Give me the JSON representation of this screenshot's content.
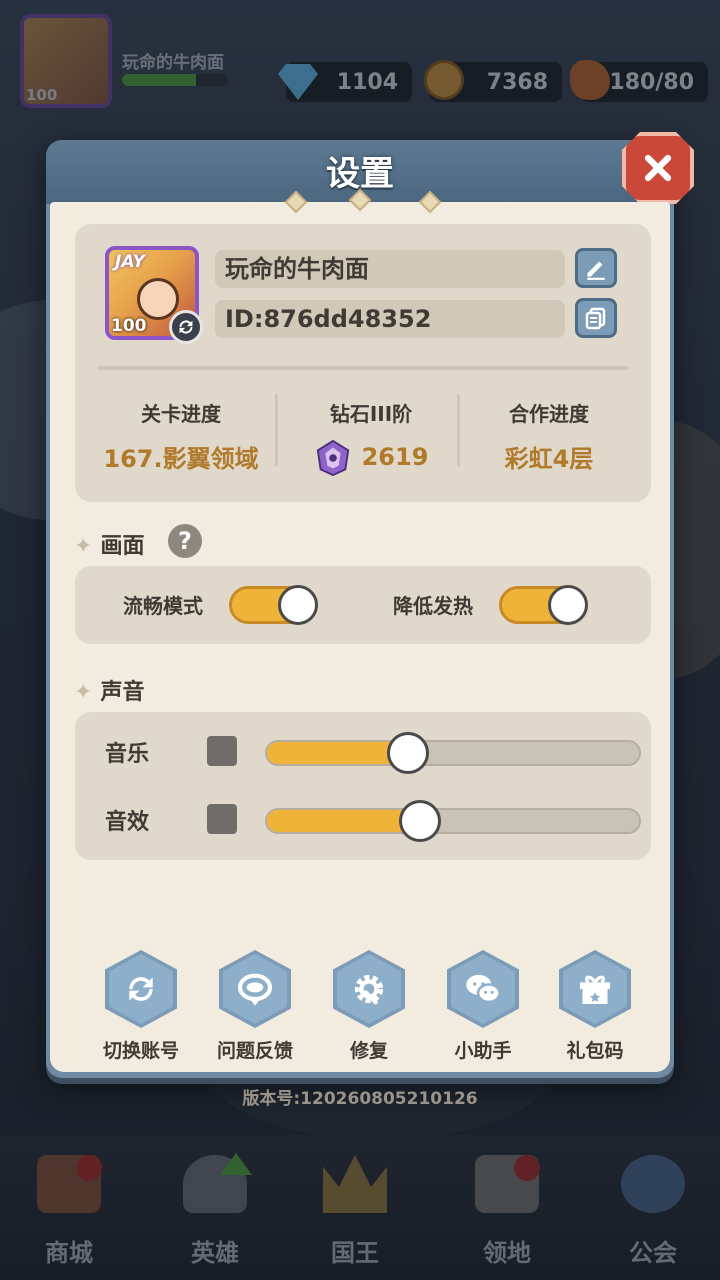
{
  "hud": {
    "player_name": "玩命的牛肉面",
    "player_level": "100",
    "xp_progress_pct": 70,
    "diamonds": "1104",
    "coins": "7368",
    "stamina": "180/80"
  },
  "dialog": {
    "title": "设置",
    "profile": {
      "brand": "JAY",
      "level": "100",
      "name": "玩命的牛肉面",
      "id": "ID:876dd48352",
      "stats": [
        {
          "label": "关卡进度",
          "value": "167.影翼领域"
        },
        {
          "label": "钻石III阶",
          "value": "2619"
        },
        {
          "label": "合作进度",
          "value": "彩虹4层"
        }
      ]
    },
    "graphics": {
      "title": "画面",
      "help": "?",
      "smooth_mode_label": "流畅模式",
      "smooth_mode_on": true,
      "reduce_heat_label": "降低发热",
      "reduce_heat_on": true
    },
    "sound": {
      "title": "声音",
      "music_label": "音乐",
      "music_level_pct": 38,
      "sfx_label": "音效",
      "sfx_level_pct": 41
    },
    "actions": [
      {
        "label": "切换账号",
        "icon": "refresh-icon"
      },
      {
        "label": "问题反馈",
        "icon": "feedback-icon"
      },
      {
        "label": "修复",
        "icon": "gear-wrench-icon"
      },
      {
        "label": "小助手",
        "icon": "wechat-icon"
      },
      {
        "label": "礼包码",
        "icon": "gift-icon"
      }
    ],
    "version": "版本号:120260805210126"
  },
  "bottom_nav": [
    {
      "label": "商城",
      "badge": true
    },
    {
      "label": "英雄",
      "badge": false
    },
    {
      "label": "国王",
      "badge": false
    },
    {
      "label": "领地",
      "badge": true
    },
    {
      "label": "公会",
      "badge": false
    }
  ],
  "colors": {
    "accent_orange": "#f0b33a",
    "dialog_blue": "#6e8ba3",
    "close_red": "#c9483a",
    "stat_gold": "#b07a2a"
  }
}
